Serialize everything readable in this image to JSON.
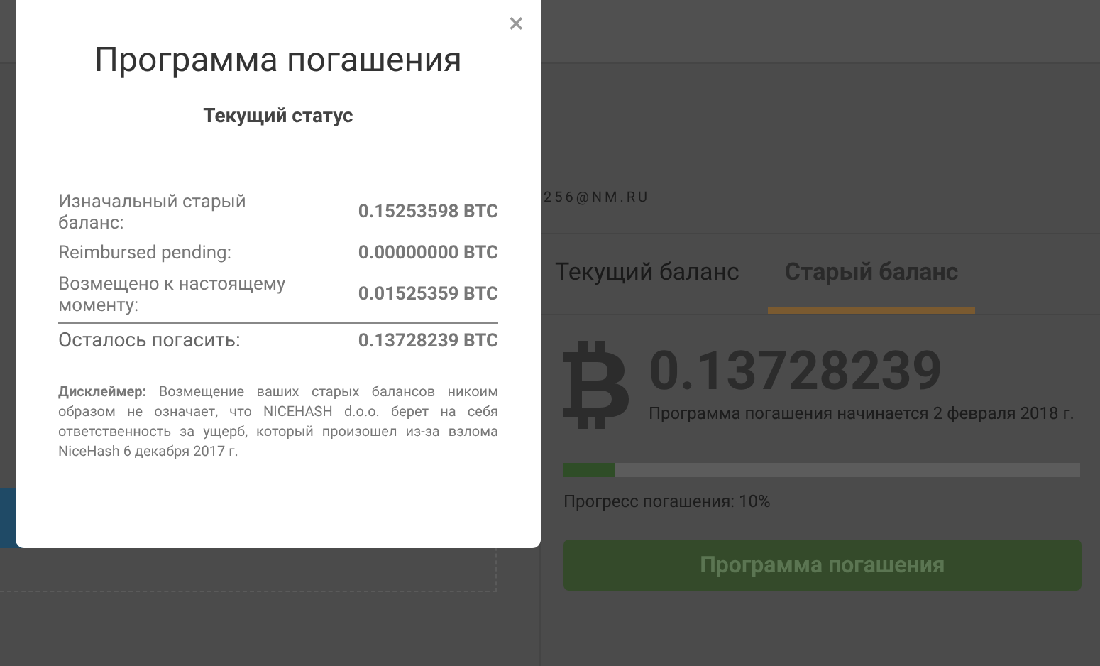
{
  "modal": {
    "title": "Программа погашения",
    "close": "×",
    "subtitle": "Текущий статус",
    "rows": [
      {
        "label": "Изначальный старый баланс:",
        "value": "0.15253598 BTC",
        "total": false
      },
      {
        "label": "Reimbursed pending:",
        "value": "0.00000000 BTC",
        "total": false
      },
      {
        "label": "Возмещено к настоящему моменту:",
        "value": "0.01525359 BTC",
        "total": false
      },
      {
        "label": "Осталось погасить:",
        "value": "0.13728239 BTC",
        "total": true
      }
    ],
    "disclaimer": "**Дисклеймер:** Возмещение ваших старых балансов никоим образом не означает, что NICEHASH d.o.o. берет на себя ответственность за ущерб, который произошел из-за взлома NiceHash 6 декабря 2017 г."
  },
  "account": {
    "email": "256@NM.RU"
  },
  "tabs": [
    {
      "label": "Текущий баланс",
      "selected": false
    },
    {
      "label": "Старый баланс",
      "selected": true
    }
  ],
  "balance": {
    "amount": "0.13728239",
    "note": "Программа погашения начинается 2 февраля 2018 г.",
    "level": 0.1,
    "progress_label": "Прогресс погашения: 10%",
    "button": "Программа погашения"
  }
}
